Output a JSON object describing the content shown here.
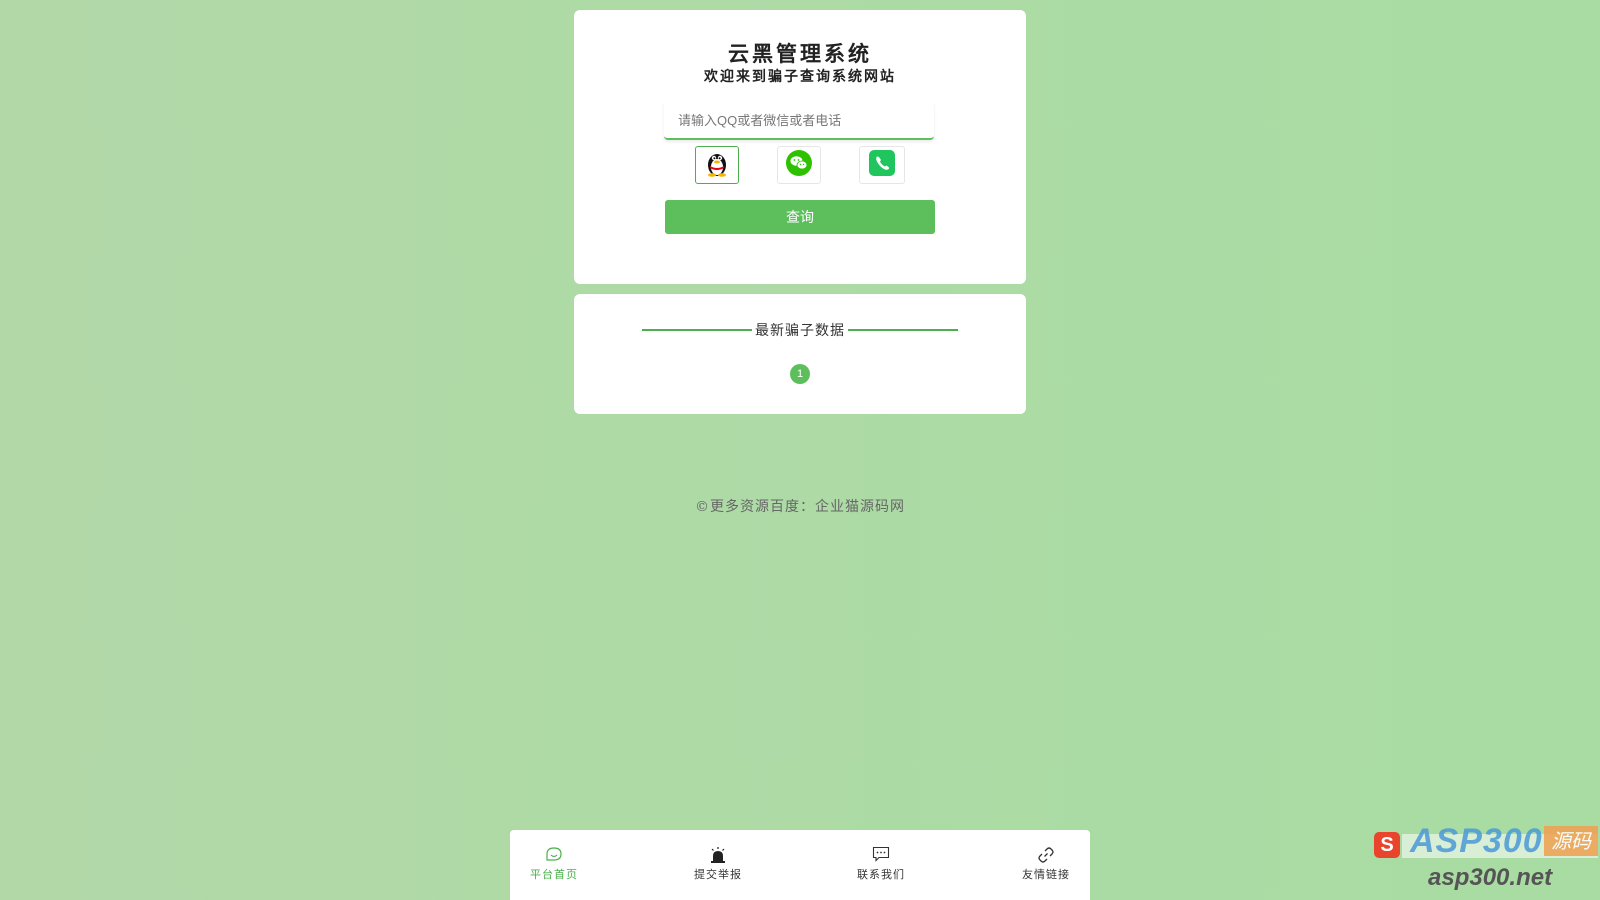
{
  "header": {
    "title": "云黑管理系统",
    "subtitle": "欢迎来到骗子查询系统网站"
  },
  "search": {
    "placeholder": "请输入QQ或者微信或者电话",
    "value": ""
  },
  "search_types": [
    {
      "icon": "qq-penguin-icon",
      "selected": true
    },
    {
      "icon": "wechat-icon",
      "selected": false
    },
    {
      "icon": "phone-icon",
      "selected": false
    }
  ],
  "query_button": {
    "label": "查询"
  },
  "latest": {
    "title": "最新骗子数据",
    "pagination": {
      "current_page": "1"
    }
  },
  "footer": {
    "copyright": "©更多资源百度：企业猫源码网"
  },
  "bottom_nav": {
    "items": [
      {
        "label": "平台首页",
        "icon": "home-icon",
        "active": true
      },
      {
        "label": "提交举报",
        "icon": "alarm-icon",
        "active": false
      },
      {
        "label": "联系我们",
        "icon": "message-icon",
        "active": false
      },
      {
        "label": "友情链接",
        "icon": "link-icon",
        "active": false
      }
    ]
  },
  "watermark": {
    "brand": "ASP300",
    "tag": "源码",
    "domain": "asp300.net"
  },
  "colors": {
    "accent": "#5cbf5c",
    "background": "#aedaa6",
    "card": "#ffffff"
  }
}
